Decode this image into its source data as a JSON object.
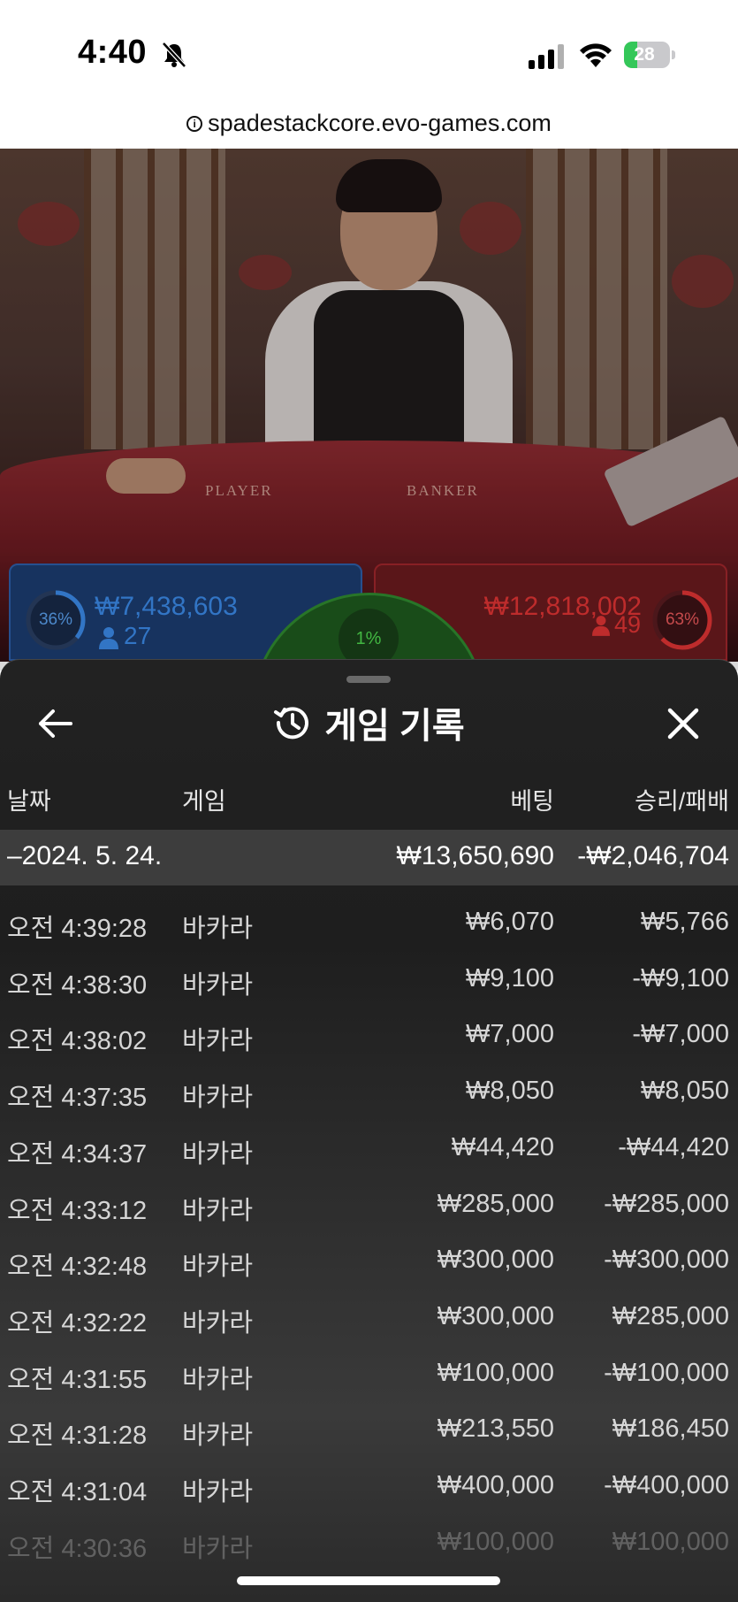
{
  "status_bar": {
    "time": "4:40",
    "battery": "28",
    "battery_level": 0.28,
    "icons": [
      "bell-slash-icon",
      "cellular-signal-icon",
      "wifi-icon",
      "battery-charging-icon"
    ]
  },
  "browser": {
    "url": "spadestackcore.evo-games.com",
    "info_icon": "i"
  },
  "video": {
    "player_label": "PLAYER",
    "banker_label": "BANKER"
  },
  "bets": {
    "player": {
      "percent": "36%",
      "percent_value": 36,
      "amount": "₩7,438,603",
      "count": "27",
      "color": "#2b7ad8"
    },
    "tie": {
      "percent": "1%",
      "color": "#4ed84e"
    },
    "banker": {
      "percent": "63%",
      "percent_value": 63,
      "amount": "₩12,818,002",
      "count": "49",
      "color": "#d42a2a"
    }
  },
  "sheet": {
    "title": "게임 기록",
    "back_icon": "arrow-left-icon",
    "close_icon": "close-icon",
    "title_icon": "history-icon",
    "columns": {
      "date": "날짜",
      "game": "게임",
      "bet": "베팅",
      "result": "승리/패배"
    },
    "date_group": {
      "date": "–2024. 5. 24.",
      "bet_total": "₩13,650,690",
      "result_total": "-₩2,046,704"
    },
    "rows": [
      {
        "time": "오전 4:39:28",
        "game": "바카라",
        "bet": "₩6,070",
        "result": "₩5,766"
      },
      {
        "time": "오전 4:38:30",
        "game": "바카라",
        "bet": "₩9,100",
        "result": "-₩9,100"
      },
      {
        "time": "오전 4:38:02",
        "game": "바카라",
        "bet": "₩7,000",
        "result": "-₩7,000"
      },
      {
        "time": "오전 4:37:35",
        "game": "바카라",
        "bet": "₩8,050",
        "result": "₩8,050"
      },
      {
        "time": "오전 4:34:37",
        "game": "바카라",
        "bet": "₩44,420",
        "result": "-₩44,420"
      },
      {
        "time": "오전 4:33:12",
        "game": "바카라",
        "bet": "₩285,000",
        "result": "-₩285,000"
      },
      {
        "time": "오전 4:32:48",
        "game": "바카라",
        "bet": "₩300,000",
        "result": "-₩300,000"
      },
      {
        "time": "오전 4:32:22",
        "game": "바카라",
        "bet": "₩300,000",
        "result": "₩285,000"
      },
      {
        "time": "오전 4:31:55",
        "game": "바카라",
        "bet": "₩100,000",
        "result": "-₩100,000"
      },
      {
        "time": "오전 4:31:28",
        "game": "바카라",
        "bet": "₩213,550",
        "result": "₩186,450"
      },
      {
        "time": "오전 4:31:04",
        "game": "바카라",
        "bet": "₩400,000",
        "result": "-₩400,000"
      },
      {
        "time": "오전 4:30:36",
        "game": "바카라",
        "bet": "₩100,000",
        "result": "₩100,000"
      }
    ]
  }
}
